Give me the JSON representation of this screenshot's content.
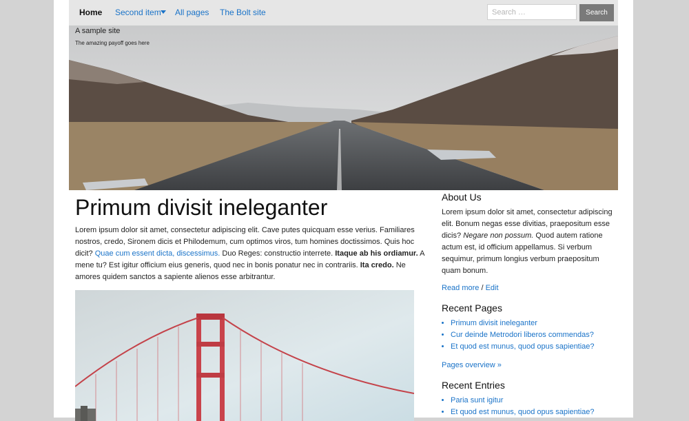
{
  "nav": {
    "items": [
      {
        "label": "Home"
      },
      {
        "label": "Second item"
      },
      {
        "label": "All pages"
      },
      {
        "label": "The Bolt site"
      }
    ]
  },
  "search": {
    "placeholder": "Search …",
    "button_label": "Search"
  },
  "hero": {
    "site_title": "A sample site",
    "tagline": "The amazing payoff goes here"
  },
  "main": {
    "title": "Primum divisit ineleganter",
    "intro": {
      "t1": "Lorem ipsum dolor sit amet, consectetur adipiscing elit. Cave putes quicquam esse verius. Familiares nostros, credo, Sironem dicis et Philodemum, cum optimos viros, tum homines doctissimos. Quis hoc dicit? ",
      "link": "Quae cum essent dicta, discessimus.",
      "t2": " Duo Reges: constructio interrete. ",
      "b1": "Itaque ab his ordiamur.",
      "t3": " A mene tu? Est igitur officium eius generis, quod nec in bonis ponatur nec in contrariis. ",
      "b2": "Ita credo.",
      "t4": " Ne amores quidem sanctos a sapiente alienos esse arbitrantur."
    }
  },
  "sidebar": {
    "about": {
      "heading": "About Us",
      "t1": "Lorem ipsum dolor sit amet, consectetur adipiscing elit. Bonum negas esse divitias, praepositum esse dicis? ",
      "em": "Negare non possum.",
      "t2": " Quod autem ratione actum est, id officium appellamus. Si verbum sequimur, primum longius verbum praepositum quam bonum.",
      "read_more": "Read more",
      "sep": " / ",
      "edit": "Edit"
    },
    "recent_pages": {
      "heading": "Recent Pages",
      "items": [
        "Primum divisit ineleganter",
        "Cur deinde Metrodori liberos commendas?",
        "Et quod est munus, quod opus sapientiae?"
      ],
      "overview": "Pages overview »"
    },
    "recent_entries": {
      "heading": "Recent Entries",
      "items": [
        "Paria sunt igitur",
        "Et quod est munus, quod opus sapientiae?"
      ]
    }
  },
  "colors": {
    "link": "#1a73c8",
    "topbar": "#e6e6e6",
    "backdrop": "#d3d3d3",
    "search_button": "#7a7a7a"
  }
}
